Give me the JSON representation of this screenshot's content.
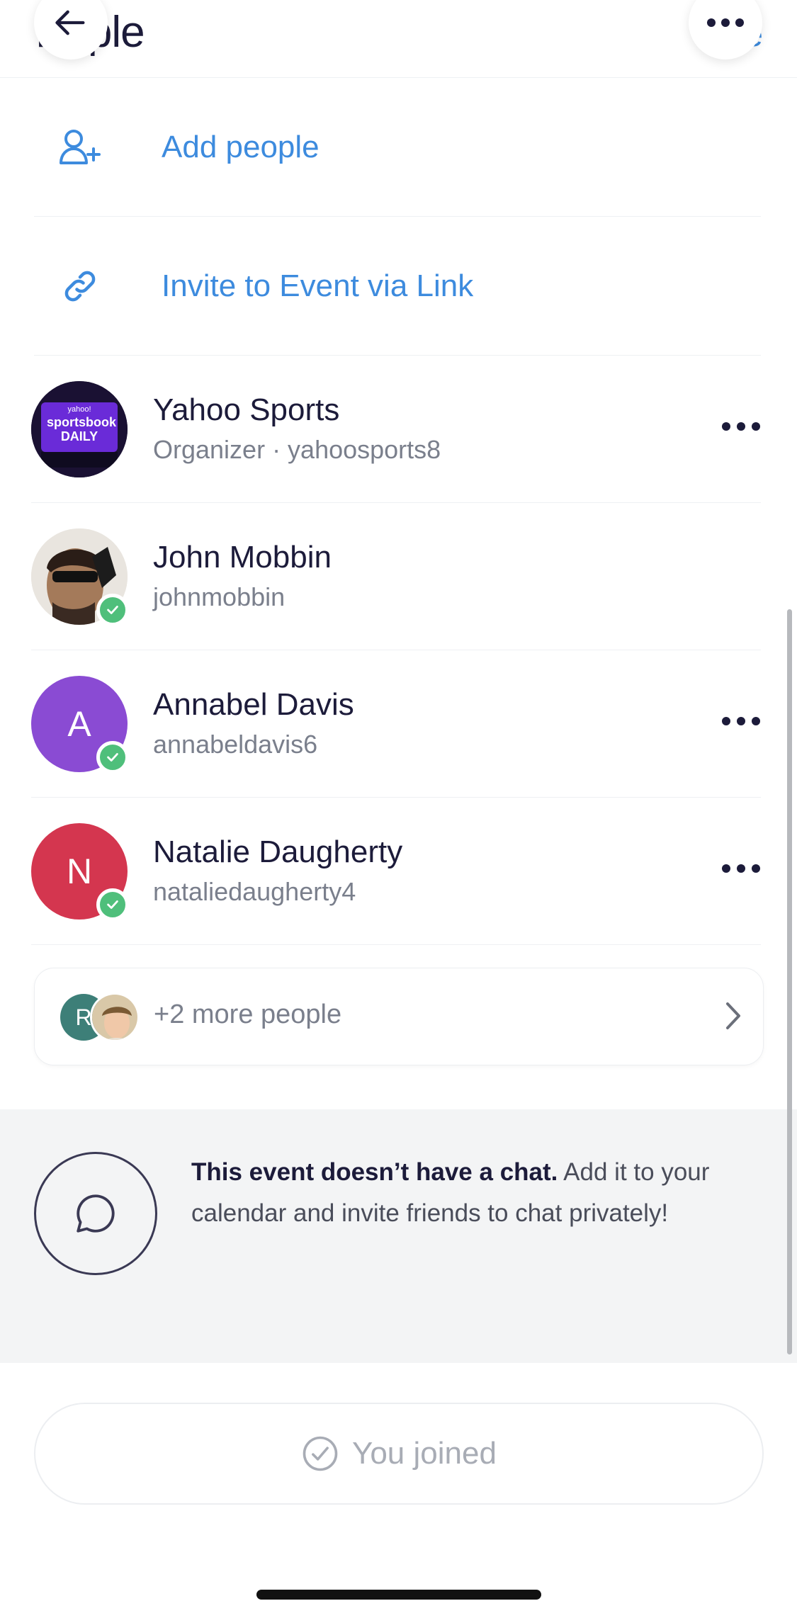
{
  "header": {
    "title": "ople",
    "partial_title_letter": "P",
    "right_link": "Se",
    "back_icon": "arrow-left-icon",
    "more_icon": "ellipsis-icon"
  },
  "actions": {
    "add_people": {
      "label": "Add people",
      "icon": "person-plus-icon"
    },
    "invite_link": {
      "label": "Invite to Event via Link",
      "icon": "link-icon"
    }
  },
  "people": [
    {
      "name": "Yahoo Sports",
      "sub": "Organizer · yahoosports8",
      "avatar_text": "sportsbook DAILY",
      "avatar_brand": "yahoo!",
      "verified": false,
      "has_more": true
    },
    {
      "name": "John Mobbin",
      "sub": "johnmobbin",
      "verified": true,
      "has_more": false
    },
    {
      "name": "Annabel Davis",
      "sub": "annabeldavis6",
      "initial": "A",
      "color": "#8a4bd3",
      "verified": true,
      "has_more": true
    },
    {
      "name": "Natalie Daugherty",
      "sub": "nataliedaugherty4",
      "initial": "N",
      "color": "#d4364f",
      "verified": true,
      "has_more": true
    }
  ],
  "more_people": {
    "label": "+2 more people",
    "avatar_initial": "R"
  },
  "chat_notice": {
    "bold": "This event doesn’t have a chat.",
    "rest": " Add it to your calendar and invite friends to chat privately!",
    "icon": "chat-bubble-icon"
  },
  "joined_button": {
    "label": "You joined",
    "icon": "check-circle-icon"
  },
  "colors": {
    "accent": "#3d8bde",
    "verified": "#4fbf7b",
    "background": "#ffffff",
    "section_bg": "#f3f4f5"
  }
}
